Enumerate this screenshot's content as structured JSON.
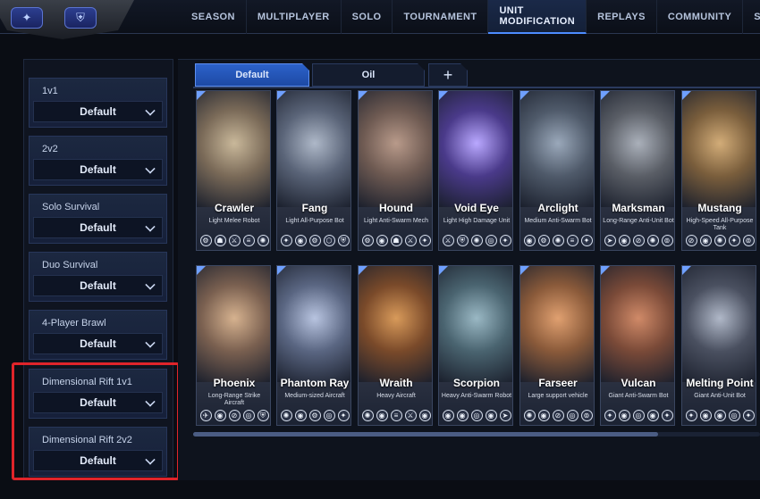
{
  "nav": {
    "items": [
      "SEASON",
      "MULTIPLAYER",
      "SOLO",
      "TOURNAMENT",
      "UNIT MODIFICATION",
      "REPLAYS",
      "COMMUNITY",
      "S"
    ],
    "active": "UNIT MODIFICATION"
  },
  "modes": [
    {
      "label": "1v1",
      "value": "Default"
    },
    {
      "label": "2v2",
      "value": "Default"
    },
    {
      "label": "Solo Survival",
      "value": "Default"
    },
    {
      "label": "Duo Survival",
      "value": "Default"
    },
    {
      "label": "4-Player Brawl",
      "value": "Default"
    },
    {
      "label": "Dimensional Rift 1v1",
      "value": "Default"
    },
    {
      "label": "Dimensional Rift 2v2",
      "value": "Default"
    }
  ],
  "tabs": {
    "default": "Default",
    "second": "Oil",
    "add": "+"
  },
  "units": [
    {
      "name": "Crawler",
      "desc": "Light Melee Robot",
      "color": "#7a6a58",
      "accent": "#c9b89a",
      "icons": [
        "⚙",
        "☗",
        "⚔",
        "≡",
        "✺"
      ]
    },
    {
      "name": "Fang",
      "desc": "Light All-Purpose Bot",
      "color": "#5a6478",
      "accent": "#aeb8c8",
      "icons": [
        "✦",
        "◉",
        "⚙",
        "⬡",
        "⛨"
      ]
    },
    {
      "name": "Hound",
      "desc": "Light Anti-Swarm Mech",
      "color": "#6e5a52",
      "accent": "#b89a8a",
      "icons": [
        "⚙",
        "◉",
        "☗",
        "⚔",
        "✦"
      ]
    },
    {
      "name": "Void Eye",
      "desc": "Light High Damage Unit",
      "color": "#4a3a8a",
      "accent": "#b9a8ff",
      "icons": [
        "⚔",
        "⛨",
        "✺",
        "◎",
        "✦"
      ]
    },
    {
      "name": "Arclight",
      "desc": "Medium Anti-Swarm Bot",
      "color": "#4f5a6a",
      "accent": "#9aa8ba",
      "icons": [
        "◉",
        "⚙",
        "✺",
        "≡",
        "✦"
      ]
    },
    {
      "name": "Marksman",
      "desc": "Long-Range Anti-Unit Bot",
      "color": "#5a5e66",
      "accent": "#aab0ba",
      "icons": [
        "➤",
        "◉",
        "⊘",
        "✺",
        "⊚"
      ]
    },
    {
      "name": "Mustang",
      "desc": "High-Speed All-Purpose Tank",
      "color": "#7a5e3c",
      "accent": "#d2ac78",
      "icons": [
        "⊘",
        "◉",
        "✺",
        "✦",
        "⊚"
      ]
    },
    {
      "name": "Phoenix",
      "desc": "Long-Range Strike Aircraft",
      "color": "#7a6050",
      "accent": "#d6b28f",
      "icons": [
        "✈",
        "◉",
        "⊘",
        "◎",
        "⛨"
      ]
    },
    {
      "name": "Phantom Ray",
      "desc": "Medium-sized Aircraft",
      "color": "#5a6682",
      "accent": "#b8c4e0",
      "icons": [
        "✺",
        "◉",
        "⚙",
        "◎",
        "✦"
      ]
    },
    {
      "name": "Wraith",
      "desc": "Heavy Aircraft",
      "color": "#7a4a2a",
      "accent": "#d89a5a",
      "icons": [
        "✺",
        "◉",
        "≡",
        "⚔",
        "◉"
      ]
    },
    {
      "name": "Scorpion",
      "desc": "Heavy Anti-Swarm Robot",
      "color": "#4a6470",
      "accent": "#9ab8c4",
      "icons": [
        "◉",
        "◉",
        "◎",
        "◉",
        "➤"
      ]
    },
    {
      "name": "Farseer",
      "desc": "Large support vehicle",
      "color": "#8a5a3a",
      "accent": "#e0a070",
      "icons": [
        "✺",
        "◉",
        "⊘",
        "◎",
        "⊚"
      ]
    },
    {
      "name": "Vulcan",
      "desc": "Giant Anti-Swarm Bot",
      "color": "#7a4a38",
      "accent": "#d08a68",
      "icons": [
        "✦",
        "◉",
        "◎",
        "◉",
        "✦"
      ]
    },
    {
      "name": "Melting Point",
      "desc": "Giant Anti-Unit Bot",
      "color": "#4a5060",
      "accent": "#b0b8c8",
      "icons": [
        "✦",
        "◉",
        "◉",
        "◎",
        "✦"
      ]
    }
  ]
}
